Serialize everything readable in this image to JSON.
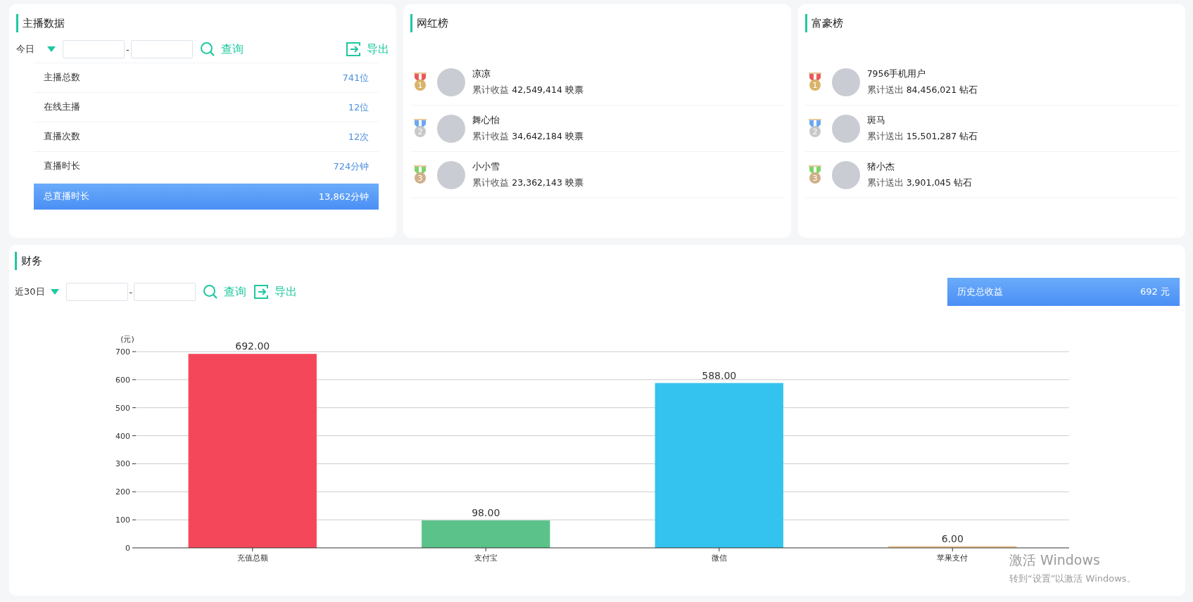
{
  "anchor_panel": {
    "title": "主播数据",
    "period": "今日",
    "separator": "-",
    "query_button": "查询",
    "export_button": "导出",
    "stats": [
      {
        "label": "主播总数",
        "value": "741位",
        "highlighted": false
      },
      {
        "label": "在线主播",
        "value": "12位",
        "highlighted": false
      },
      {
        "label": "直播次数",
        "value": "12次",
        "highlighted": false
      },
      {
        "label": "直播时长",
        "value": "724分钟",
        "highlighted": false
      },
      {
        "label": "总直播时长",
        "value": "13,862分钟",
        "highlighted": true
      }
    ]
  },
  "influencer_panel": {
    "title": "网红榜",
    "entries": [
      {
        "rank": "1",
        "color": "#e85a5a",
        "name": "凉凉",
        "metric_label": "累计收益",
        "amount": "42,549,414",
        "unit": "映票"
      },
      {
        "rank": "2",
        "color": "#6aa8f0",
        "name": "舞心怡",
        "metric_label": "累计收益",
        "amount": "34,642,184",
        "unit": "映票"
      },
      {
        "rank": "3",
        "color": "#7ed46a",
        "name": "小小雪",
        "metric_label": "累计收益",
        "amount": "23,362,143",
        "unit": "映票"
      }
    ]
  },
  "rich_panel": {
    "title": "富豪榜",
    "entries": [
      {
        "rank": "1",
        "color": "#e85a5a",
        "name": "7956手机用户",
        "metric_label": "累计送出",
        "amount": "84,456,021",
        "unit": "钻石"
      },
      {
        "rank": "2",
        "color": "#6aa8f0",
        "name": "斑马",
        "metric_label": "累计送出",
        "amount": "15,501,287",
        "unit": "钻石"
      },
      {
        "rank": "3",
        "color": "#7ed46a",
        "name": "猪小杰",
        "metric_label": "累计送出",
        "amount": "3,901,045",
        "unit": "钻石"
      }
    ]
  },
  "finance_panel": {
    "title": "财务",
    "period": "近30日",
    "separator": "-",
    "query_button": "查询",
    "export_button": "导出",
    "summary": {
      "label": "历史总收益",
      "value": "692 元"
    },
    "chart_data": {
      "type": "bar",
      "ylabel": "(元)",
      "categories": [
        "充值总额",
        "支付宝",
        "微信",
        "苹果支付"
      ],
      "values": [
        692,
        98,
        588,
        6
      ],
      "colors": [
        "#f5475a",
        "#5bc28a",
        "#34c3ef",
        "#f2c58f"
      ],
      "ylim": [
        0,
        700
      ],
      "yticks": [
        0,
        100,
        200,
        300,
        400,
        500,
        600,
        700
      ],
      "data_labels": true,
      "grid": true,
      "value_labels": [
        "692.00",
        "98.00",
        "588.00",
        "6.00"
      ]
    }
  },
  "os_overlay": {
    "title": "激活 Windows",
    "subtitle": "转到“设置”以激活 Windows。"
  }
}
